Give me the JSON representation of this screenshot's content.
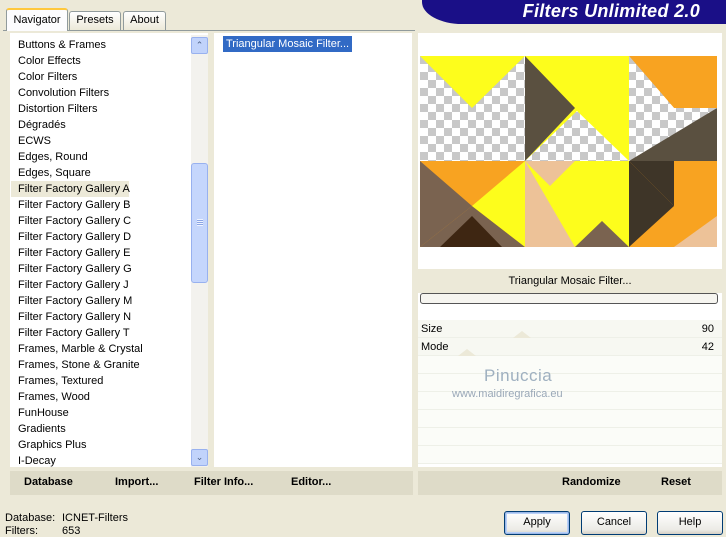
{
  "tabs": [
    {
      "label": "Navigator",
      "active": true
    },
    {
      "label": "Presets",
      "active": false
    },
    {
      "label": "About",
      "active": false
    }
  ],
  "banner_title": "Filters Unlimited 2.0",
  "categories": [
    "Buttons & Frames",
    "Color Effects",
    "Color Filters",
    "Convolution Filters",
    "Distortion Filters",
    "Dégradés",
    "ECWS",
    "Edges, Round",
    "Edges, Square",
    "Filter Factory Gallery A",
    "Filter Factory Gallery B",
    "Filter Factory Gallery C",
    "Filter Factory Gallery D",
    "Filter Factory Gallery E",
    "Filter Factory Gallery G",
    "Filter Factory Gallery J",
    "Filter Factory Gallery M",
    "Filter Factory Gallery N",
    "Filter Factory Gallery T",
    "Frames, Marble & Crystal",
    "Frames, Stone & Granite",
    "Frames, Textured",
    "Frames, Wood",
    "FunHouse",
    "Gradients",
    "Graphics Plus",
    "I-Decay"
  ],
  "selected_category": "Filter Factory Gallery A",
  "filters": [
    "Triangular Mosaic Filter..."
  ],
  "selected_filter_name": "Triangular Mosaic Filter...",
  "params": [
    {
      "label": "Size",
      "value": "90"
    },
    {
      "label": "Mode",
      "value": "42"
    }
  ],
  "watermark": {
    "line1": "Pinuccia",
    "line2": "www.maidiregrafica.eu"
  },
  "left_bar": {
    "database": "Database",
    "import": "Import...",
    "filter_info": "Filter Info...",
    "editor": "Editor..."
  },
  "right_bar": {
    "randomize": "Randomize",
    "reset": "Reset"
  },
  "status": {
    "database_label": "Database:",
    "database_value": "ICNET-Filters",
    "filters_label": "Filters:",
    "filters_value": "653"
  },
  "buttons": {
    "apply": "Apply",
    "cancel": "Cancel",
    "help": "Help"
  },
  "scrollbar": {
    "up_glyph": "⌃",
    "down_glyph": "⌄"
  },
  "colors": {
    "selection": "#316ac5",
    "banner": "#1a0f87",
    "yellow": "#fdfd1c",
    "orange": "#f8a321",
    "brown_dark": "#5a5040",
    "tan": "#edc298"
  }
}
